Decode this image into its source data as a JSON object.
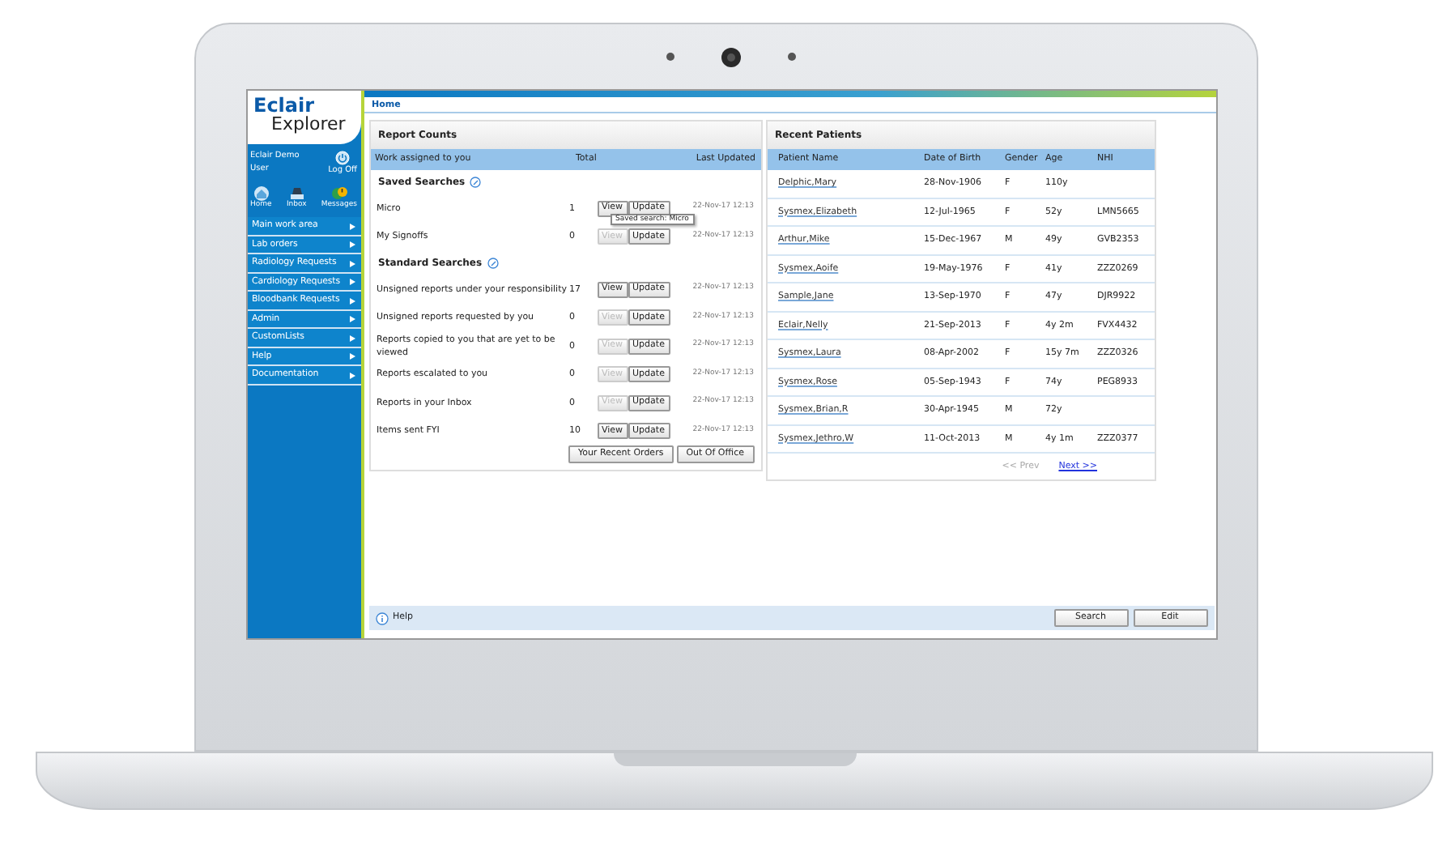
{
  "sidebar": {
    "logo": {
      "line1": "Eclair",
      "line2": "Explorer"
    },
    "user": "Eclair Demo User",
    "logoff": "Log Off",
    "shortcuts": [
      {
        "kind": "home",
        "label": "Home"
      },
      {
        "kind": "inbox",
        "label": "Inbox"
      },
      {
        "kind": "messages",
        "label": "Messages"
      }
    ],
    "menu": [
      {
        "label": "Main work area"
      },
      {
        "label": "Lab orders"
      },
      {
        "label": "Radiology Requests"
      },
      {
        "label": "Cardiology Requests"
      },
      {
        "label": "Bloodbank Requests"
      },
      {
        "label": "Admin"
      },
      {
        "label": "CustomLists"
      },
      {
        "label": "Help"
      },
      {
        "label": "Documentation"
      }
    ]
  },
  "breadcrumb": "Home",
  "report_counts": {
    "title": "Report Counts",
    "columns": [
      "Work assigned to you",
      "Total",
      "Last Updated"
    ],
    "sections": [
      {
        "title": "Saved Searches",
        "rows": [
          {
            "name": "Micro",
            "total": "1",
            "view_enabled": true,
            "view": "View",
            "update": "Update",
            "updated": "22-Nov-17 12:13"
          },
          {
            "name": "My Signoffs",
            "total": "0",
            "view_enabled": false,
            "view": "View",
            "update": "Update",
            "updated": "22-Nov-17 12:13"
          }
        ]
      },
      {
        "title": "Standard Searches",
        "rows": [
          {
            "name": "Unsigned reports under your responsibility",
            "total": "17",
            "view_enabled": true,
            "view": "View",
            "update": "Update",
            "updated": "22-Nov-17 12:13"
          },
          {
            "name": "Unsigned reports requested by you",
            "total": "0",
            "view_enabled": false,
            "view": "View",
            "update": "Update",
            "updated": "22-Nov-17 12:13"
          },
          {
            "name": "Reports copied to you that are yet to be viewed",
            "total": "0",
            "view_enabled": false,
            "view": "View",
            "update": "Update",
            "updated": "22-Nov-17 12:13"
          },
          {
            "name": "Reports escalated to you",
            "total": "0",
            "view_enabled": false,
            "view": "View",
            "update": "Update",
            "updated": "22-Nov-17 12:13"
          },
          {
            "name": "Reports in your Inbox",
            "total": "0",
            "view_enabled": false,
            "view": "View",
            "update": "Update",
            "updated": "22-Nov-17 12:13"
          },
          {
            "name": "Items sent FYI",
            "total": "10",
            "view_enabled": true,
            "view": "View",
            "update": "Update",
            "updated": "22-Nov-17 12:13"
          }
        ]
      }
    ],
    "tooltip": "Saved search: Micro",
    "buttons": [
      "Your Recent Orders",
      "Out Of Office"
    ]
  },
  "recent_patients": {
    "title": "Recent Patients",
    "columns": [
      "Patient Name",
      "Date of Birth",
      "Gender",
      "Age",
      "NHI"
    ],
    "rows": [
      [
        "Delphic,Mary",
        "28-Nov-1906",
        "F",
        "110y",
        ""
      ],
      [
        "Sysmex,Elizabeth",
        "12-Jul-1965",
        "F",
        "52y",
        "LMN5665"
      ],
      [
        "Arthur,Mike",
        "15-Dec-1967",
        "M",
        "49y",
        "GVB2353"
      ],
      [
        "Sysmex,Aoife",
        "19-May-1976",
        "F",
        "41y",
        "ZZZ0269"
      ],
      [
        "Sample,Jane",
        "13-Sep-1970",
        "F",
        "47y",
        "DJR9922"
      ],
      [
        "Eclair,Nelly",
        "21-Sep-2013",
        "F",
        "4y 2m",
        "FVX4432"
      ],
      [
        "Sysmex,Laura",
        "08-Apr-2002",
        "F",
        "15y 7m",
        "ZZZ0326"
      ],
      [
        "Sysmex,Rose",
        "05-Sep-1943",
        "F",
        "74y",
        "PEG8933"
      ],
      [
        "Sysmex,Brian,R",
        "30-Apr-1945",
        "M",
        "72y",
        ""
      ],
      [
        "Sysmex,Jethro,W",
        "11-Oct-2013",
        "M",
        "4y 1m",
        "ZZZ0377"
      ]
    ],
    "prev": {
      "label": "<< Prev",
      "disabled": true
    },
    "next": {
      "label": "Next >>",
      "disabled": false
    }
  },
  "footer": {
    "help": "Help",
    "buttons": [
      "Search",
      "Edit"
    ]
  }
}
